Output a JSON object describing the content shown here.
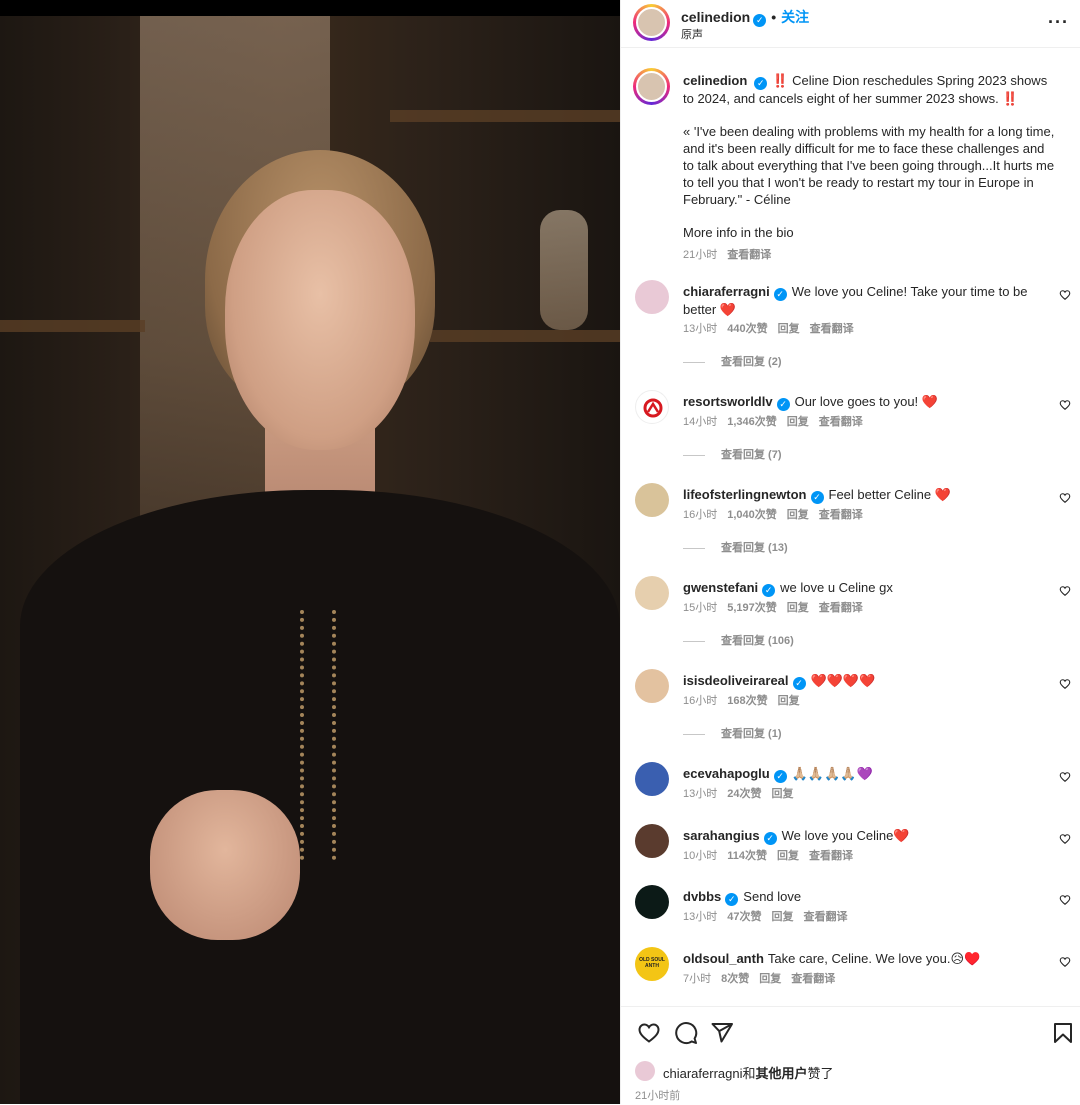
{
  "post": {
    "username": "celinedion",
    "verified_mark": "✓",
    "dot": "•",
    "follow_label": "关注",
    "subtitle": "原声",
    "more_label": "···"
  },
  "caption": {
    "username": "celinedion",
    "line1": "‼️ Celine Dion reschedules Spring 2023 shows to 2024, and cancels eight of her summer 2023 shows. ‼️",
    "line2": "« 'I've been dealing with problems with my health for a long time, and it's been really difficult for me to face these challenges and to talk about everything that I've been going through...It hurts me to tell you that I won't be ready to restart my tour in Europe in February.\" - Céline",
    "line3": "More info in the bio",
    "time": "21小时",
    "translate": "查看翻译"
  },
  "comments": [
    {
      "username": "chiaraferragni",
      "verified": true,
      "text": "We love you Celine! Take your time to be better ❤️",
      "time": "13小时",
      "likes": "440次赞",
      "reply": "回复",
      "translate": "查看翻译",
      "view_replies": "查看回复 (2)",
      "avatar_color": "#e9c9d6"
    },
    {
      "username": "resortsworldlv",
      "verified": true,
      "text": "Our love goes to you! ❤️",
      "time": "14小时",
      "likes": "1,346次赞",
      "reply": "回复",
      "translate": "查看翻译",
      "view_replies": "查看回复 (7)",
      "avatar_color": "#ffffff"
    },
    {
      "username": "lifeofsterlingnewton",
      "verified": true,
      "text": "Feel better Celine ❤️",
      "time": "16小时",
      "likes": "1,040次赞",
      "reply": "回复",
      "translate": "查看翻译",
      "view_replies": "查看回复 (13)",
      "avatar_color": "#d9c39a"
    },
    {
      "username": "gwenstefani",
      "verified": true,
      "text": "we love u Celine gx",
      "time": "15小时",
      "likes": "5,197次赞",
      "reply": "回复",
      "translate": "查看翻译",
      "view_replies": "查看回复 (106)",
      "avatar_color": "#e6cfae"
    },
    {
      "username": "isisdeoliveirareal",
      "verified": true,
      "text": "❤️❤️❤️❤️",
      "time": "16小时",
      "likes": "168次赞",
      "reply": "回复",
      "translate": "",
      "view_replies": "查看回复 (1)",
      "avatar_color": "#e3c2a0"
    },
    {
      "username": "ecevahapoglu",
      "verified": true,
      "text": "🙏🏼🙏🏼🙏🏼🙏🏼💜",
      "time": "13小时",
      "likes": "24次赞",
      "reply": "回复",
      "translate": "",
      "view_replies": "",
      "avatar_color": "#3a5fb0"
    },
    {
      "username": "sarahangius",
      "verified": true,
      "text": "We love you Celine❤️",
      "time": "10小时",
      "likes": "114次赞",
      "reply": "回复",
      "translate": "查看翻译",
      "view_replies": "",
      "avatar_color": "#5a3b2e"
    },
    {
      "username": "dvbbs",
      "verified": true,
      "text": "Send love",
      "time": "13小时",
      "likes": "47次赞",
      "reply": "回复",
      "translate": "查看翻译",
      "view_replies": "",
      "avatar_color": "#0c1a17"
    },
    {
      "username": "oldsoul_anth",
      "verified": false,
      "text": "Take care, Celine. We love you.😥♥️",
      "time": "7小时",
      "likes": "8次赞",
      "reply": "回复",
      "translate": "查看翻译",
      "view_replies": "",
      "avatar_color": "#f3c515",
      "avatar_text": "OLD SOUL ANTH"
    }
  ],
  "footer": {
    "liked_by_user": "chiaraferragni",
    "liked_joiner": "和",
    "liked_others": "其他用户",
    "liked_suffix": "赞了",
    "time": "21小时前"
  },
  "colors": {
    "accent": "#0095f6",
    "heart": "#ed4956",
    "muted": "#8e8e8e"
  },
  "icons": [
    "heart-icon",
    "comment-icon",
    "share-icon",
    "bookmark-icon",
    "more-icon",
    "verified-icon"
  ]
}
